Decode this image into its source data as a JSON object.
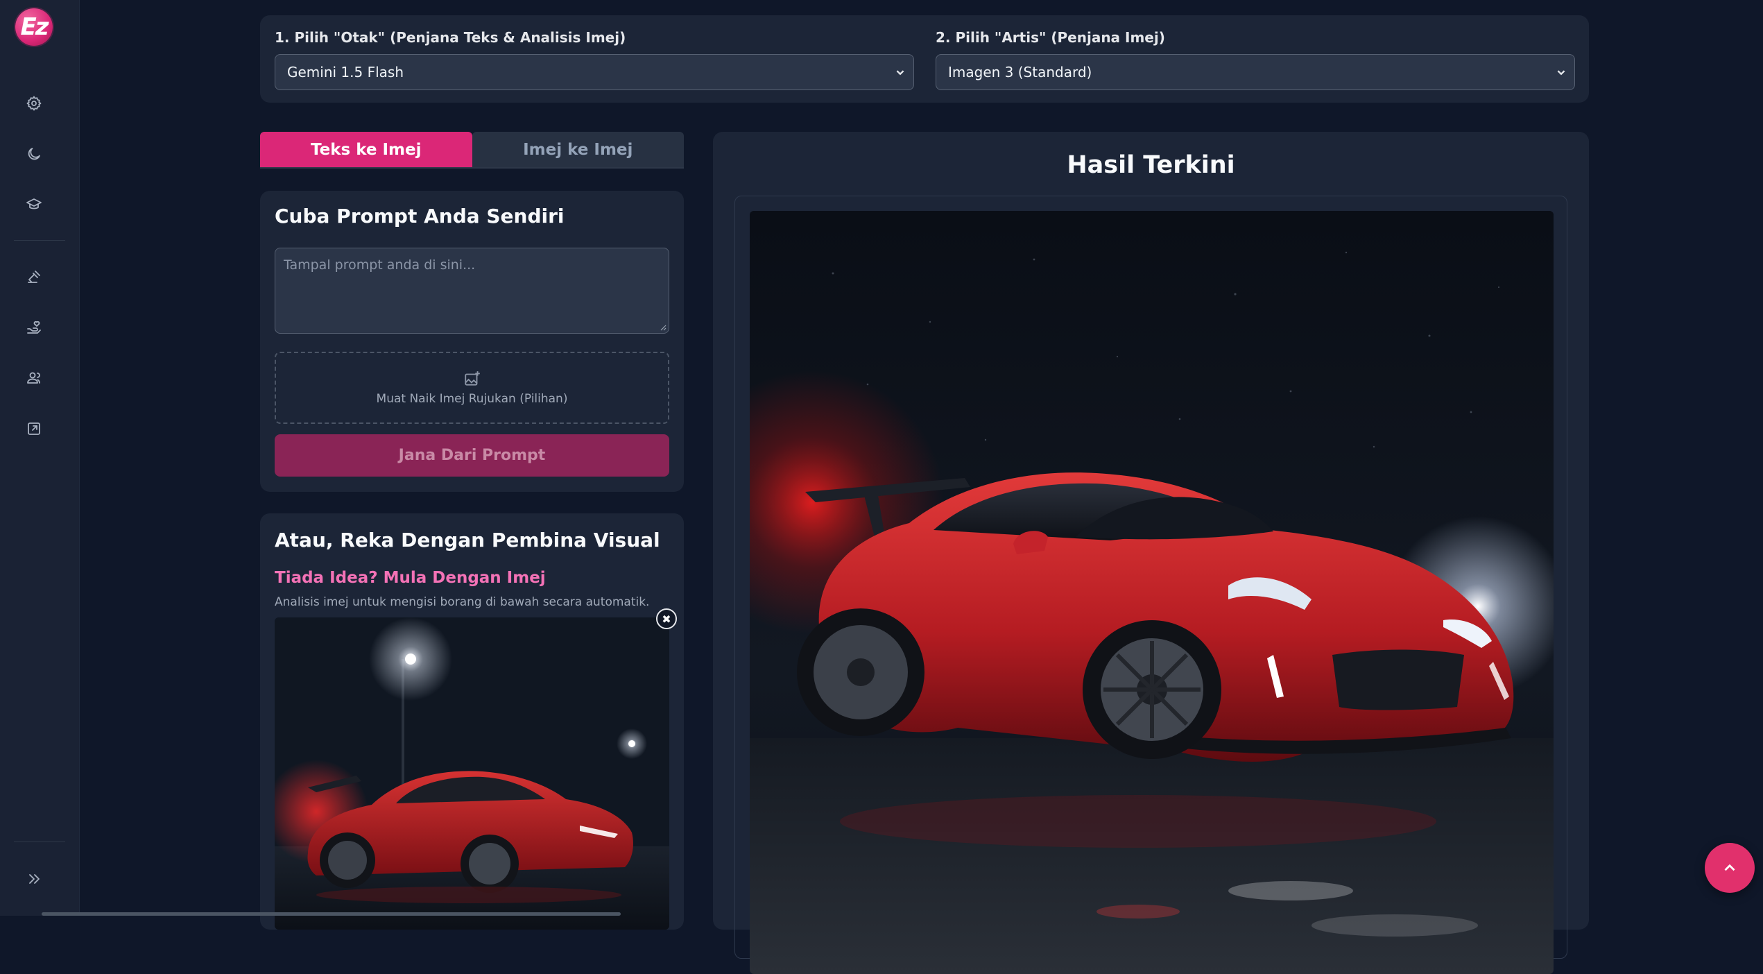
{
  "app": {
    "logo_text": "Ez"
  },
  "sidebar": {
    "icons": [
      {
        "name": "settings-icon"
      },
      {
        "name": "moon-icon"
      },
      {
        "name": "graduation-cap-icon"
      },
      {
        "name": "gavel-icon"
      },
      {
        "name": "hand-heart-icon"
      },
      {
        "name": "user-group-icon"
      },
      {
        "name": "external-link-icon"
      }
    ],
    "expand_icon": "chevrons-right-icon"
  },
  "models": {
    "brain_label": "1. Pilih \"Otak\" (Penjana Teks & Analisis Imej)",
    "brain_value": "Gemini 1.5 Flash",
    "artist_label": "2. Pilih \"Artis\" (Penjana Imej)",
    "artist_value": "Imagen 3 (Standard)"
  },
  "tabs": [
    {
      "label": "Teks ke Imej",
      "active": true
    },
    {
      "label": "Imej ke Imej",
      "active": false
    }
  ],
  "prompt_card": {
    "title": "Cuba Prompt Anda Sendiri",
    "placeholder": "Tampal prompt anda di sini...",
    "upload_label": "Muat Naik Imej Rujukan (Pilihan)",
    "generate_button": "Jana Dari Prompt"
  },
  "visual_card": {
    "title": "Atau, Reka Dengan Pembina Visual",
    "subtitle": "Tiada Idea? Mula Dengan Imej",
    "description": "Analisis imej untuk mengisi borang di bawah secara automatik.",
    "close_symbol": "✖"
  },
  "result": {
    "title": "Hasil Terkini"
  },
  "colors": {
    "accent": "#db2777",
    "background": "#0f1729",
    "card": "#1c2537"
  }
}
